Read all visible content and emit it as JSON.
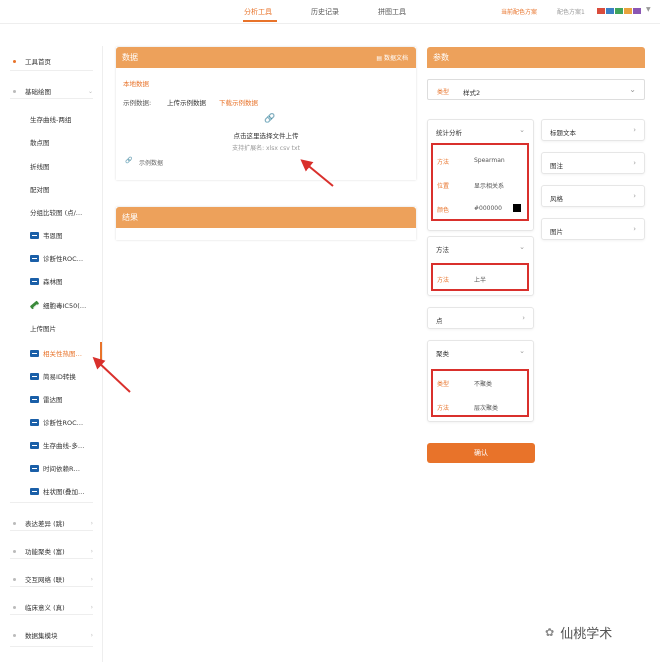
{
  "topnav": {
    "tabs": [
      "分析工具",
      "历史记录",
      "拼图工具"
    ],
    "scheme_label": "当前配色方案",
    "scheme_code": "配色方案1",
    "swatches": [
      "#d94c3c",
      "#3b7fc4",
      "#3fa45a",
      "#e8a33d",
      "#8a56b3"
    ]
  },
  "sidebar": {
    "items": [
      {
        "label": "工具首页",
        "icon": "dot"
      },
      {
        "label": "基础绘图",
        "icon": "dot-grey"
      },
      {
        "label": "生存曲线-两组",
        "icon": "none"
      },
      {
        "label": "散点图",
        "icon": "none"
      },
      {
        "label": "折线图",
        "icon": "none"
      },
      {
        "label": "配对图",
        "icon": "none"
      },
      {
        "label": "分组比较图 (点/…",
        "icon": "none"
      },
      {
        "label": "韦恩图",
        "icon": "chart-icon"
      },
      {
        "label": "诊断性ROC…",
        "icon": "chart-icon"
      },
      {
        "label": "森林图",
        "icon": "chart-icon"
      },
      {
        "label": "细胞毒IC50(…",
        "icon": "pill-icon"
      },
      {
        "label": "上传图片",
        "icon": "none"
      },
      {
        "label": "相关性热图…",
        "icon": "chart-icon"
      },
      {
        "label": "简易ID转换",
        "icon": "chart-icon"
      },
      {
        "label": "雷达图",
        "icon": "chart-icon"
      },
      {
        "label": "诊断性ROC…",
        "icon": "chart-icon"
      },
      {
        "label": "生存曲线-多…",
        "icon": "chart-icon"
      },
      {
        "label": "时间依赖R…",
        "icon": "chart-icon"
      },
      {
        "label": "柱状图(叠加…",
        "icon": "chart-icon"
      },
      {
        "label": "表达差异 (跳)",
        "icon": "dot-grey"
      },
      {
        "label": "功能聚类 (富)",
        "icon": "dot-grey"
      },
      {
        "label": "交互网络 (联)",
        "icon": "dot-grey"
      },
      {
        "label": "临床意义 (真)",
        "icon": "dot-grey"
      },
      {
        "label": "数据集模块",
        "icon": "dot-grey"
      }
    ]
  },
  "data_panel": {
    "title": "数据",
    "doc_label": "数据文档",
    "local_data": "本地数据",
    "example_label": "示例数据:",
    "upload_example": "上传示例数据",
    "download_example": "下载示例数据",
    "upload_hint": "点击这里选择文件上传",
    "ext_hint": "支持扩展名: xlsx csv txt",
    "attach_label": "示例数据"
  },
  "result_panel": {
    "title": "结果"
  },
  "params": {
    "title": "参数",
    "type_label": "类型",
    "type_value": "样式2",
    "stats": {
      "title": "统计分析",
      "method_label": "方法",
      "method_value": "Spearman",
      "position_label": "位置",
      "position_value": "显示相关系",
      "color_label": "颜色",
      "color_value": "#000000"
    },
    "method_card": {
      "title": "方法",
      "method_label": "方法",
      "method_value": "上半"
    },
    "point_card": {
      "title": "点"
    },
    "cluster_card": {
      "title": "聚类",
      "type_label": "类型",
      "type_value": "不聚类",
      "method_label": "方法",
      "method_value": "层次聚类"
    },
    "side_cards": [
      "标题文本",
      "图注",
      "风格",
      "图片"
    ],
    "confirm": "确认"
  },
  "watermark": "仙桃学术"
}
